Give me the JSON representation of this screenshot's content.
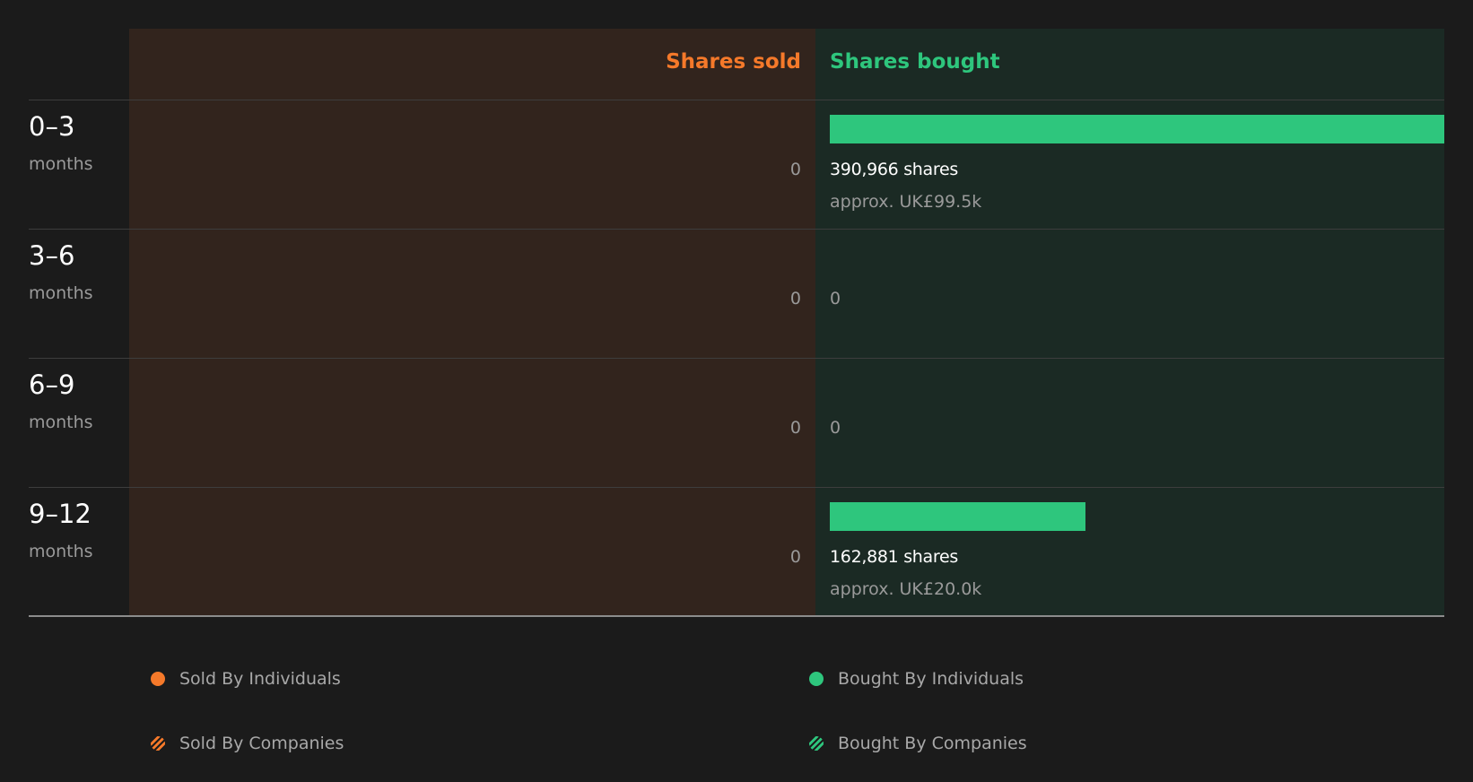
{
  "header": {
    "sold": "Shares sold",
    "bought": "Shares bought"
  },
  "colors": {
    "sold": "#f5792a",
    "bought": "#2ec67d",
    "sold_bg": "#32241d",
    "bought_bg": "#1b2a24"
  },
  "chart_data": {
    "type": "bar",
    "categories": [
      "0–3",
      "3–6",
      "6–9",
      "9–12"
    ],
    "category_unit": "months",
    "series": [
      {
        "name": "Shares sold",
        "values": [
          0,
          0,
          0,
          0
        ],
        "labels": [
          "0",
          "0",
          "0",
          "0"
        ]
      },
      {
        "name": "Shares bought",
        "values": [
          390966,
          0,
          0,
          162881
        ],
        "labels": [
          "390,966 shares",
          "0",
          "0",
          "162,881 shares"
        ],
        "approx": [
          "approx. UK£99.5k",
          "",
          "",
          "approx. UK£20.0k"
        ]
      }
    ]
  },
  "rows": [
    {
      "range": "0–3",
      "unit": "months",
      "sold": "0",
      "bought": "390,966 shares",
      "approx": "approx. UK£99.5k"
    },
    {
      "range": "3–6",
      "unit": "months",
      "sold": "0",
      "bought": "0"
    },
    {
      "range": "6–9",
      "unit": "months",
      "sold": "0",
      "bought": "0"
    },
    {
      "range": "9–12",
      "unit": "months",
      "sold": "0",
      "bought": "162,881 shares",
      "approx": "approx. UK£20.0k"
    }
  ],
  "legend": {
    "sold_individuals": "Sold By Individuals",
    "bought_individuals": "Bought By Individuals",
    "sold_companies": "Sold By Companies",
    "bought_companies": "Bought By Companies"
  }
}
